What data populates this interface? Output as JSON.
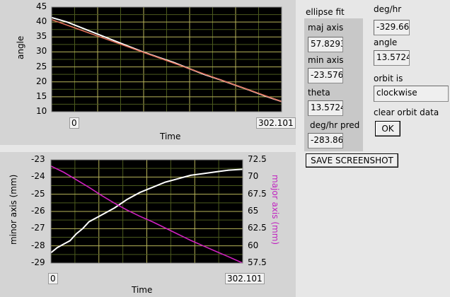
{
  "chart_data": [
    {
      "type": "scatter",
      "xlabel": "Time",
      "ylabel": "angle",
      "xlim": [
        0,
        302.101
      ],
      "ylim": [
        10,
        45
      ],
      "x_tick_labels": [
        "0",
        "302.101"
      ],
      "y_ticks": [
        10,
        15,
        20,
        25,
        30,
        35,
        40,
        45
      ],
      "grid": true,
      "series": [
        {
          "color": "#ffffff",
          "x": [
            0,
            20,
            40,
            60,
            80,
            100,
            120,
            140,
            160,
            180,
            200,
            220,
            240,
            260,
            280,
            302.101
          ],
          "y": [
            41.5,
            40.0,
            38.0,
            36.0,
            34.0,
            32.0,
            30.0,
            28.2,
            26.5,
            24.5,
            22.5,
            20.8,
            19.0,
            17.2,
            15.3,
            13.4
          ]
        },
        {
          "color": "#e0705a",
          "x": [
            0,
            302.101
          ],
          "y": [
            40.8,
            13.4
          ]
        }
      ]
    },
    {
      "type": "line",
      "xlabel": "Time",
      "ylabel": "minor axis (mm)",
      "y2label": "major  axis (mm)",
      "xlim": [
        0,
        302.101
      ],
      "ylim": [
        -29,
        -23
      ],
      "y2lim": [
        57.5,
        72.5
      ],
      "x_tick_labels": [
        "0",
        "302.101"
      ],
      "y_ticks": [
        -29,
        -28,
        -27,
        -26,
        -25,
        -24,
        -23
      ],
      "y2_ticks": [
        57.5,
        60,
        62.5,
        65,
        67.5,
        70,
        72.5
      ],
      "grid": true,
      "series": [
        {
          "axis": "left",
          "color": "#ffffff",
          "x": [
            0,
            10,
            20,
            30,
            40,
            50,
            60,
            70,
            80,
            100,
            120,
            140,
            160,
            180,
            200,
            220,
            240,
            260,
            280,
            302.101
          ],
          "y": [
            -28.4,
            -28.1,
            -27.9,
            -27.7,
            -27.3,
            -27.0,
            -26.6,
            -26.4,
            -26.2,
            -25.8,
            -25.3,
            -24.9,
            -24.6,
            -24.3,
            -24.1,
            -23.9,
            -23.8,
            -23.7,
            -23.6,
            -23.55
          ]
        },
        {
          "axis": "right",
          "color": "#d020c0",
          "x": [
            0,
            20,
            40,
            60,
            80,
            100,
            120,
            140,
            160,
            180,
            200,
            220,
            240,
            260,
            280,
            302.101
          ],
          "y": [
            71.6,
            70.7,
            69.6,
            68.5,
            67.3,
            66.2,
            65.2,
            64.3,
            63.5,
            62.6,
            61.7,
            60.8,
            60.0,
            59.2,
            58.4,
            57.5
          ]
        }
      ]
    }
  ],
  "top_chart": {
    "ylabel": "angle",
    "xlabel": "Time",
    "x_start": "0",
    "x_end": "302.101",
    "y_ticks": [
      "45",
      "40",
      "35",
      "30",
      "25",
      "20",
      "15",
      "10"
    ]
  },
  "bottom_chart": {
    "ylabel": "minor axis (mm)",
    "y2label": "major  axis (mm)",
    "xlabel": "Time",
    "x_start": "0",
    "x_end": "302.101",
    "y_ticks": [
      "-23",
      "-24",
      "-25",
      "-26",
      "-27",
      "-28",
      "-29"
    ],
    "y2_ticks": [
      "72.5",
      "70",
      "67.5",
      "65",
      "62.5",
      "60",
      "57.5"
    ]
  },
  "ellipse_fit": {
    "title": "ellipse fit",
    "maj_axis_label": "maj axis",
    "maj_axis_value": "57.8293",
    "min_axis_label": "min axis",
    "min_axis_value": "-23.576",
    "theta_label": "theta",
    "theta_value": "13.5724",
    "pred_label": "deg/hr pred",
    "pred_value": "-283.86"
  },
  "right": {
    "deg_hr_label": "deg/hr",
    "deg_hr_value": "-329.66",
    "angle_label": "angle",
    "angle_value": "13.5724",
    "orbit_label": "orbit is",
    "orbit_value": "clockwise",
    "clear_label": "clear orbit data",
    "ok_label": "OK"
  },
  "screenshot_button": "SAVE SCREENSHOT"
}
